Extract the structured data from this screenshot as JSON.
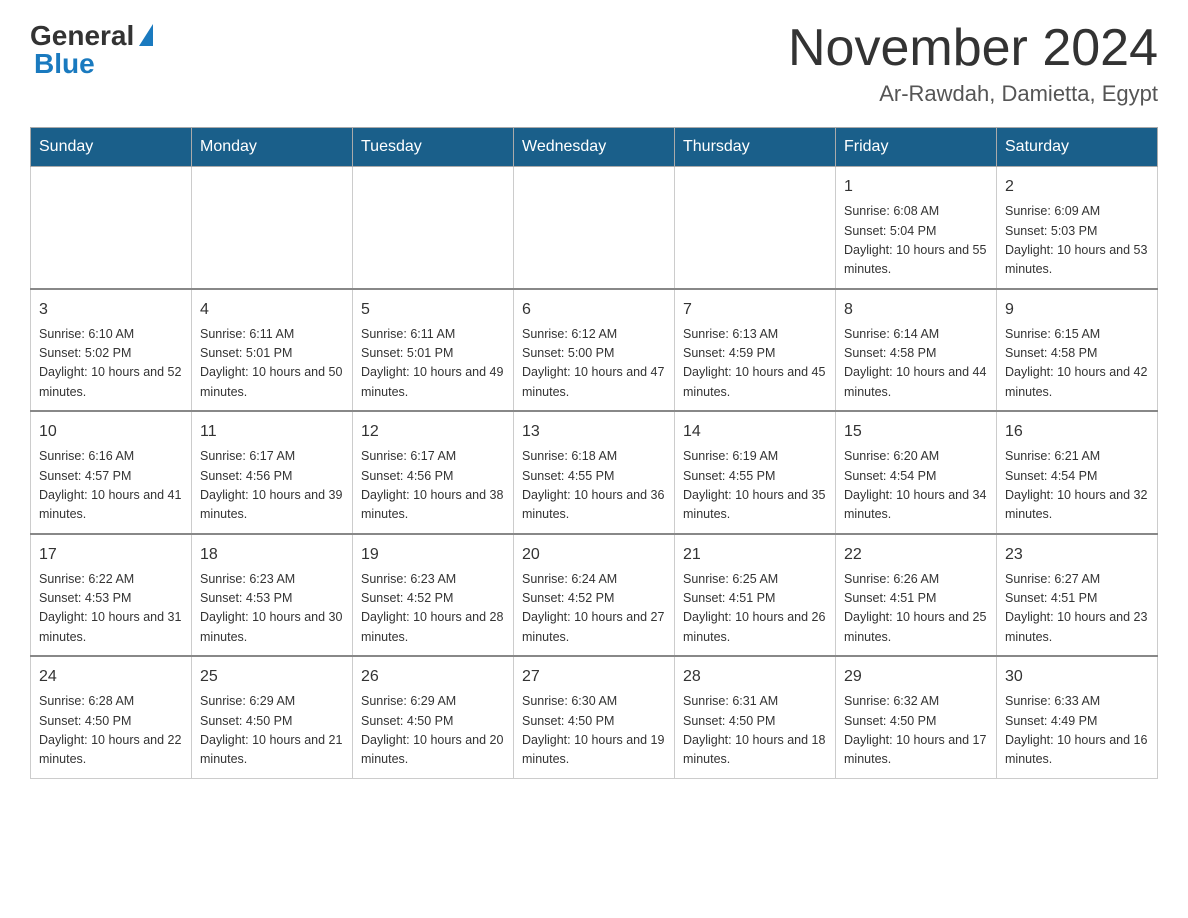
{
  "logo": {
    "general": "General",
    "blue": "Blue"
  },
  "title": "November 2024",
  "location": "Ar-Rawdah, Damietta, Egypt",
  "days_header": [
    "Sunday",
    "Monday",
    "Tuesday",
    "Wednesday",
    "Thursday",
    "Friday",
    "Saturday"
  ],
  "weeks": [
    [
      {
        "day": "",
        "info": ""
      },
      {
        "day": "",
        "info": ""
      },
      {
        "day": "",
        "info": ""
      },
      {
        "day": "",
        "info": ""
      },
      {
        "day": "",
        "info": ""
      },
      {
        "day": "1",
        "info": "Sunrise: 6:08 AM\nSunset: 5:04 PM\nDaylight: 10 hours and 55 minutes."
      },
      {
        "day": "2",
        "info": "Sunrise: 6:09 AM\nSunset: 5:03 PM\nDaylight: 10 hours and 53 minutes."
      }
    ],
    [
      {
        "day": "3",
        "info": "Sunrise: 6:10 AM\nSunset: 5:02 PM\nDaylight: 10 hours and 52 minutes."
      },
      {
        "day": "4",
        "info": "Sunrise: 6:11 AM\nSunset: 5:01 PM\nDaylight: 10 hours and 50 minutes."
      },
      {
        "day": "5",
        "info": "Sunrise: 6:11 AM\nSunset: 5:01 PM\nDaylight: 10 hours and 49 minutes."
      },
      {
        "day": "6",
        "info": "Sunrise: 6:12 AM\nSunset: 5:00 PM\nDaylight: 10 hours and 47 minutes."
      },
      {
        "day": "7",
        "info": "Sunrise: 6:13 AM\nSunset: 4:59 PM\nDaylight: 10 hours and 45 minutes."
      },
      {
        "day": "8",
        "info": "Sunrise: 6:14 AM\nSunset: 4:58 PM\nDaylight: 10 hours and 44 minutes."
      },
      {
        "day": "9",
        "info": "Sunrise: 6:15 AM\nSunset: 4:58 PM\nDaylight: 10 hours and 42 minutes."
      }
    ],
    [
      {
        "day": "10",
        "info": "Sunrise: 6:16 AM\nSunset: 4:57 PM\nDaylight: 10 hours and 41 minutes."
      },
      {
        "day": "11",
        "info": "Sunrise: 6:17 AM\nSunset: 4:56 PM\nDaylight: 10 hours and 39 minutes."
      },
      {
        "day": "12",
        "info": "Sunrise: 6:17 AM\nSunset: 4:56 PM\nDaylight: 10 hours and 38 minutes."
      },
      {
        "day": "13",
        "info": "Sunrise: 6:18 AM\nSunset: 4:55 PM\nDaylight: 10 hours and 36 minutes."
      },
      {
        "day": "14",
        "info": "Sunrise: 6:19 AM\nSunset: 4:55 PM\nDaylight: 10 hours and 35 minutes."
      },
      {
        "day": "15",
        "info": "Sunrise: 6:20 AM\nSunset: 4:54 PM\nDaylight: 10 hours and 34 minutes."
      },
      {
        "day": "16",
        "info": "Sunrise: 6:21 AM\nSunset: 4:54 PM\nDaylight: 10 hours and 32 minutes."
      }
    ],
    [
      {
        "day": "17",
        "info": "Sunrise: 6:22 AM\nSunset: 4:53 PM\nDaylight: 10 hours and 31 minutes."
      },
      {
        "day": "18",
        "info": "Sunrise: 6:23 AM\nSunset: 4:53 PM\nDaylight: 10 hours and 30 minutes."
      },
      {
        "day": "19",
        "info": "Sunrise: 6:23 AM\nSunset: 4:52 PM\nDaylight: 10 hours and 28 minutes."
      },
      {
        "day": "20",
        "info": "Sunrise: 6:24 AM\nSunset: 4:52 PM\nDaylight: 10 hours and 27 minutes."
      },
      {
        "day": "21",
        "info": "Sunrise: 6:25 AM\nSunset: 4:51 PM\nDaylight: 10 hours and 26 minutes."
      },
      {
        "day": "22",
        "info": "Sunrise: 6:26 AM\nSunset: 4:51 PM\nDaylight: 10 hours and 25 minutes."
      },
      {
        "day": "23",
        "info": "Sunrise: 6:27 AM\nSunset: 4:51 PM\nDaylight: 10 hours and 23 minutes."
      }
    ],
    [
      {
        "day": "24",
        "info": "Sunrise: 6:28 AM\nSunset: 4:50 PM\nDaylight: 10 hours and 22 minutes."
      },
      {
        "day": "25",
        "info": "Sunrise: 6:29 AM\nSunset: 4:50 PM\nDaylight: 10 hours and 21 minutes."
      },
      {
        "day": "26",
        "info": "Sunrise: 6:29 AM\nSunset: 4:50 PM\nDaylight: 10 hours and 20 minutes."
      },
      {
        "day": "27",
        "info": "Sunrise: 6:30 AM\nSunset: 4:50 PM\nDaylight: 10 hours and 19 minutes."
      },
      {
        "day": "28",
        "info": "Sunrise: 6:31 AM\nSunset: 4:50 PM\nDaylight: 10 hours and 18 minutes."
      },
      {
        "day": "29",
        "info": "Sunrise: 6:32 AM\nSunset: 4:50 PM\nDaylight: 10 hours and 17 minutes."
      },
      {
        "day": "30",
        "info": "Sunrise: 6:33 AM\nSunset: 4:49 PM\nDaylight: 10 hours and 16 minutes."
      }
    ]
  ]
}
